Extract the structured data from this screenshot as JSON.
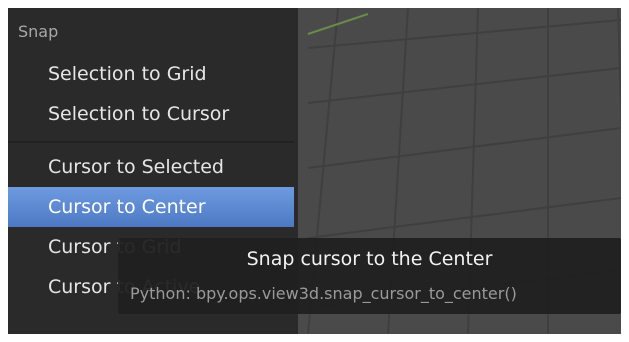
{
  "menu": {
    "title": "Snap",
    "items": [
      {
        "label": "Selection to Grid"
      },
      {
        "label": "Selection to Cursor"
      },
      {
        "label": "Cursor to Selected"
      },
      {
        "label": "Cursor to Center"
      },
      {
        "label": "Cursor to Grid"
      },
      {
        "label": "Cursor to Active"
      }
    ]
  },
  "tooltip": {
    "title": "Snap cursor to the Center",
    "python": "Python: bpy.ops.view3d.snap_cursor_to_center()"
  },
  "colors": {
    "viewport_bg": "#4a4a4a",
    "menu_bg": "#282828",
    "highlight": "#5b87d2",
    "grid_line": "#3f3f3f"
  }
}
